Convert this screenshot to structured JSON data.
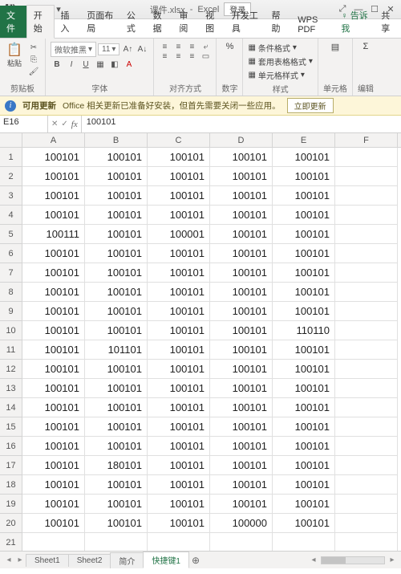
{
  "title": {
    "filename": "课件.xlsx",
    "app": "Excel",
    "login": "登录"
  },
  "qat": {
    "save": "💾",
    "undo": "↶",
    "redo": "↷",
    "more": "▾"
  },
  "winctl": {
    "min": "—",
    "max": "☐",
    "close": "✕",
    "ribbon_min": "⤢"
  },
  "tabs": {
    "file": "文件",
    "home": "开始",
    "insert": "插入",
    "layout": "页面布局",
    "formulas": "公式",
    "data": "数据",
    "review": "审阅",
    "view": "视图",
    "dev": "开发工具",
    "help": "帮助",
    "wps": "WPS PDF",
    "tellme": "告诉我",
    "share": "共享"
  },
  "ribbon": {
    "clipboard": {
      "paste": "粘贴",
      "label": "剪贴板",
      "cut": "✂",
      "copy": "⎘",
      "brush": "🖌"
    },
    "font": {
      "name": "微软推黑",
      "size": "11",
      "label": "字体",
      "bold": "B",
      "italic": "I",
      "underline": "U",
      "increase": "A↑",
      "decrease": "A↓",
      "border": "▦",
      "fill": "◧",
      "color": "A"
    },
    "align": {
      "label": "对齐方式",
      "wrap": "⤶",
      "merge": "▭"
    },
    "number": {
      "label": "数字",
      "btn": "%"
    },
    "styles": {
      "cond": "条件格式",
      "table": "套用表格格式",
      "cell": "单元格样式",
      "label": "样式"
    },
    "cells": {
      "label": "单元格"
    },
    "editing": {
      "label": "编辑"
    }
  },
  "notice": {
    "title": "可用更新",
    "msg": "Office 相关更新已准备好安装，但首先需要关闭一些应用。",
    "btn": "立即更新"
  },
  "namebox": "E16",
  "formula": "100101",
  "columns": [
    "A",
    "B",
    "C",
    "D",
    "E",
    "F"
  ],
  "grid": [
    [
      "100101",
      "100101",
      "100101",
      "100101",
      "100101",
      ""
    ],
    [
      "100101",
      "100101",
      "100101",
      "100101",
      "100101",
      ""
    ],
    [
      "100101",
      "100101",
      "100101",
      "100101",
      "100101",
      ""
    ],
    [
      "100101",
      "100101",
      "100101",
      "100101",
      "100101",
      ""
    ],
    [
      "100111",
      "100101",
      "100001",
      "100101",
      "100101",
      ""
    ],
    [
      "100101",
      "100101",
      "100101",
      "100101",
      "100101",
      ""
    ],
    [
      "100101",
      "100101",
      "100101",
      "100101",
      "100101",
      ""
    ],
    [
      "100101",
      "100101",
      "100101",
      "100101",
      "100101",
      ""
    ],
    [
      "100101",
      "100101",
      "100101",
      "100101",
      "100101",
      ""
    ],
    [
      "100101",
      "100101",
      "100101",
      "100101",
      "110110",
      ""
    ],
    [
      "100101",
      "101101",
      "100101",
      "100101",
      "100101",
      ""
    ],
    [
      "100101",
      "100101",
      "100101",
      "100101",
      "100101",
      ""
    ],
    [
      "100101",
      "100101",
      "100101",
      "100101",
      "100101",
      ""
    ],
    [
      "100101",
      "100101",
      "100101",
      "100101",
      "100101",
      ""
    ],
    [
      "100101",
      "100101",
      "100101",
      "100101",
      "100101",
      ""
    ],
    [
      "100101",
      "100101",
      "100101",
      "100101",
      "100101",
      ""
    ],
    [
      "100101",
      "180101",
      "100101",
      "100101",
      "100101",
      ""
    ],
    [
      "100101",
      "100101",
      "100101",
      "100101",
      "100101",
      ""
    ],
    [
      "100101",
      "100101",
      "100101",
      "100101",
      "100101",
      ""
    ],
    [
      "100101",
      "100101",
      "100101",
      "100000",
      "100101",
      ""
    ],
    [
      "",
      "",
      "",
      "",
      "",
      ""
    ]
  ],
  "sheets": {
    "s1": "Sheet1",
    "s2": "Sheet2",
    "s3": "简介",
    "s4": "快捷键1"
  }
}
